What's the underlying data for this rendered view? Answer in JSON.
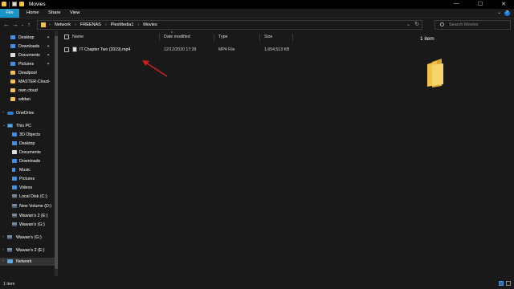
{
  "window": {
    "title": "Movies",
    "controls": [
      "—",
      "☐",
      "✕"
    ]
  },
  "ribbon": {
    "tabs": [
      "File",
      "Home",
      "Share",
      "View"
    ]
  },
  "address": {
    "crumbs": [
      "Network",
      "FREENAS",
      "PlexMedia1",
      "Movies"
    ],
    "search_placeholder": "Search Movies"
  },
  "nav": {
    "quick_access": [
      {
        "label": "Desktop",
        "icon": "desktop-icon",
        "pinned": true
      },
      {
        "label": "Downloads",
        "icon": "downloads-icon",
        "pinned": true
      },
      {
        "label": "Documents",
        "icon": "documents-icon",
        "pinned": true
      },
      {
        "label": "Pictures",
        "icon": "pictures-icon",
        "pinned": true
      },
      {
        "label": "Deadpool",
        "icon": "folder-icon",
        "pinned": false
      },
      {
        "label": "MASTER-Cloud-",
        "icon": "folder-icon",
        "pinned": false
      },
      {
        "label": "own cloud",
        "icon": "folder-icon",
        "pinned": false
      },
      {
        "label": "wildan",
        "icon": "folder-icon",
        "pinned": false
      }
    ],
    "onedrive": "OneDrive",
    "this_pc": "This PC",
    "this_pc_items": [
      {
        "label": "3D Objects",
        "icon": "3d-objects-icon"
      },
      {
        "label": "Desktop",
        "icon": "desktop-icon"
      },
      {
        "label": "Documents",
        "icon": "documents-icon"
      },
      {
        "label": "Downloads",
        "icon": "downloads-icon"
      },
      {
        "label": "Music",
        "icon": "music-icon"
      },
      {
        "label": "Pictures",
        "icon": "pictures-icon"
      },
      {
        "label": "Videos",
        "icon": "videos-icon"
      },
      {
        "label": "Local Disk (C:)",
        "icon": "drive-icon"
      },
      {
        "label": "New Volume (D:)",
        "icon": "drive-icon"
      },
      {
        "label": "Wawan's 2 (E:)",
        "icon": "drive-icon"
      },
      {
        "label": "Wawan's (G:)",
        "icon": "drive-icon"
      }
    ],
    "extra_drives": [
      "Wawan's (G:)",
      "Wawan's 2 (E:)"
    ],
    "network": "Network"
  },
  "columns": {
    "name": "Name",
    "date": "Date modified",
    "type": "Type",
    "size": "Size"
  },
  "files": [
    {
      "name": "IT Chapter Two (2019).mp4",
      "date": "12/12/2020 17:39",
      "type": "MP4 File",
      "size": "1,654,513 KB"
    }
  ],
  "preview": {
    "count": "1 item"
  },
  "status": {
    "text": "1 item"
  },
  "colors": {
    "accent": "#1a93c6",
    "folder": "#f3c349",
    "arrow": "#d11f1f"
  }
}
